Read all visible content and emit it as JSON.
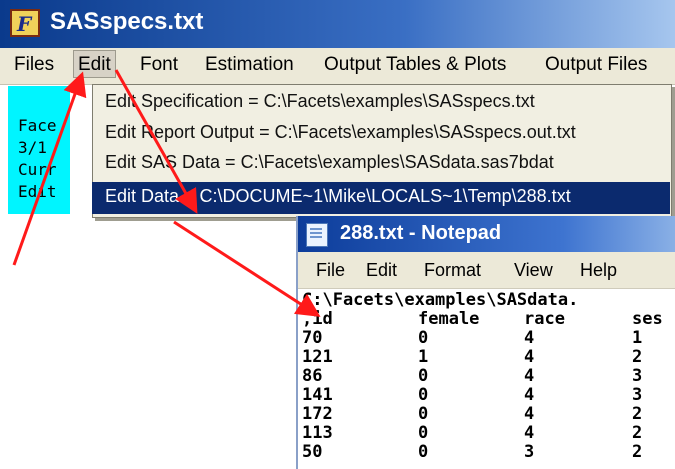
{
  "window": {
    "title": "SASspecs.txt",
    "icon": "F"
  },
  "menubar": {
    "items": [
      "Files",
      "Edit",
      "Font",
      "Estimation",
      "Output Tables & Plots",
      "Output Files"
    ]
  },
  "left_panel": {
    "lines": [
      "Face",
      "3/1",
      "Curr",
      "Edit"
    ]
  },
  "edit_menu": {
    "items": [
      "Edit Specification = C:\\Facets\\examples\\SASspecs.txt",
      "Edit Report Output = C:\\Facets\\examples\\SASspecs.out.txt",
      "Edit SAS Data = C:\\Facets\\examples\\SASdata.sas7bdat",
      "Edit Data = C:\\DOCUME~1\\Mike\\LOCALS~1\\Temp\\288.txt"
    ],
    "highlighted_index": 3
  },
  "notepad": {
    "title": "288.txt - Notepad",
    "menu": [
      "File",
      "Edit",
      "Format",
      "View",
      "Help"
    ],
    "path_line": "C:\\Facets\\examples\\SASdata.",
    "columns": [
      ",id",
      "female",
      "race",
      "ses"
    ],
    "rows": [
      [
        "70",
        "0",
        "4",
        "1"
      ],
      [
        "121",
        "1",
        "4",
        "2"
      ],
      [
        "86",
        "0",
        "4",
        "3"
      ],
      [
        "141",
        "0",
        "4",
        "3"
      ],
      [
        "172",
        "0",
        "4",
        "2"
      ],
      [
        "113",
        "0",
        "4",
        "2"
      ],
      [
        "50",
        "0",
        "3",
        "2"
      ]
    ]
  },
  "colors": {
    "arrow": "#ff1a1a",
    "highlight": "#0b2a6e",
    "panel": "#00f5ff"
  }
}
